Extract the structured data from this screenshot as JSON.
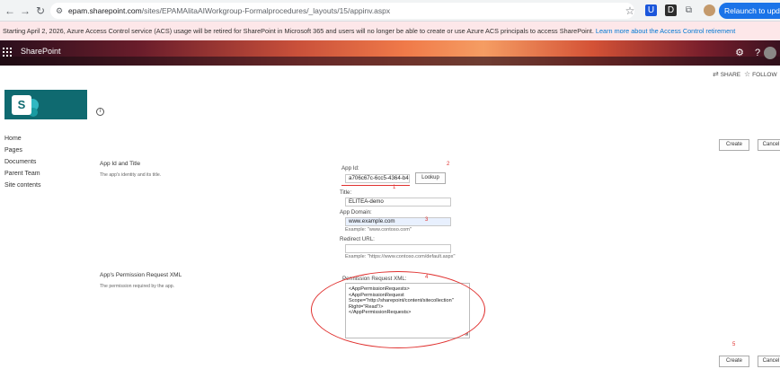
{
  "browser": {
    "url_host": "epam.sharepoint.com",
    "url_path": "/sites/EPAMAlitaAIWorkgroup-Formalprocedures/_layouts/15/appinv.aspx",
    "relaunch_label": "Relaunch to update",
    "ext_u": "U",
    "ext_d": "D"
  },
  "notice": {
    "text": "Starting April 2, 2026, Azure Access Control service (ACS) usage will be retired for SharePoint in Microsoft 365 and users will no longer be able to create or use Azure ACS principals to access SharePoint.",
    "link": "Learn more about the Access Control retirement"
  },
  "suitebar": {
    "title": "SharePoint"
  },
  "actions": {
    "share": "SHARE",
    "follow": "FOLLOW"
  },
  "site": {
    "logo_letter": "S"
  },
  "leftnav": [
    "Home",
    "Pages",
    "Documents",
    "Parent Team",
    "Site contents"
  ],
  "buttons": {
    "create": "Create",
    "cancel": "Cancel",
    "lookup": "Lookup"
  },
  "section_app": {
    "heading": "App Id and Title",
    "description": "The app's identity and its title."
  },
  "section_perm": {
    "heading": "App's Permission Request XML",
    "description": "The permission required by the app."
  },
  "form": {
    "app_id_label": "App Id:",
    "app_id_value": "a706c67c-6cc5-4364-b4",
    "title_label": "Title:",
    "title_value": "ELITEA-demo",
    "domain_label": "App Domain:",
    "domain_value": "www.example.com",
    "domain_hint": "Example: \"www.contoso.com\"",
    "redirect_label": "Redirect URL:",
    "redirect_value": "",
    "redirect_hint": "Example: \"https://www.contoso.com/default.aspx\"",
    "xml_label": "Permission Request XML:",
    "xml_lines": [
      "<AppPermissionRequests>",
      "    <AppPermissionRequest",
      "Scope=\"http://sharepoint/content/sitecollection\"",
      "Right=\"Read\"/>",
      "</AppPermissionRequests>"
    ]
  },
  "annotations": {
    "n1": "1",
    "n2": "2",
    "n3": "3",
    "n4": "4",
    "n5": "5"
  },
  "colors": {
    "annotation": "#e0312f",
    "link": "#0078d4",
    "logo": "#0f6a70",
    "banner": "#fde7e9"
  }
}
